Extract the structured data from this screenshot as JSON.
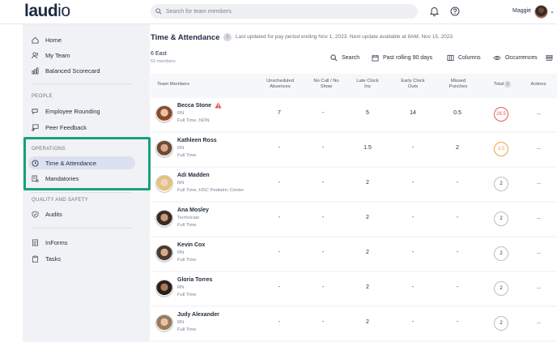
{
  "header": {
    "logo_main": "laud",
    "logo_suffix": "io",
    "search_placeholder": "Search for team members",
    "user_name": "Maggie"
  },
  "sidebar": {
    "top_items": [
      {
        "label": "Home",
        "icon": "home-icon"
      },
      {
        "label": "My Team",
        "icon": "team-icon"
      },
      {
        "label": "Balanced Scorecard",
        "icon": "scorecard-icon"
      }
    ],
    "people_title": "PEOPLE",
    "people_items": [
      {
        "label": "Employee Rounding",
        "icon": "rounding-icon"
      },
      {
        "label": "Peer Feedback",
        "icon": "feedback-icon"
      }
    ],
    "operations_title": "OPERATIONS",
    "operations_items": [
      {
        "label": "Time & Attendance",
        "icon": "clock-icon",
        "active": true
      },
      {
        "label": "Mandatories",
        "icon": "mandatories-icon"
      }
    ],
    "quality_title": "QUALITY AND SAFETY",
    "quality_items": [
      {
        "label": "Audits",
        "icon": "shield-check-icon"
      }
    ],
    "bottom_items": [
      {
        "label": "InForms",
        "icon": "form-icon"
      },
      {
        "label": "Tasks",
        "icon": "clipboard-icon"
      }
    ]
  },
  "page": {
    "title": "Time & Attendance",
    "updated": "Last updated for pay period ending Nov 1, 2023. Next update available at 8AM, Nov 15, 2023",
    "unit": "6 East",
    "members": "53 members",
    "toolbar": {
      "search": "Search",
      "period": "Past rolling 90 days",
      "columns": "Columns",
      "occurrences": "Occurrences"
    }
  },
  "table": {
    "headers": {
      "team_members": "Team Members",
      "unscheduled": "Unscheduled Absences",
      "no_call": "No Call / No Show",
      "late_clock": "Late Clock Ins",
      "early_clock": "Early Clock Outs",
      "missed": "Missed Punches",
      "total": "Total",
      "actions": "Actions"
    },
    "rows": [
      {
        "name": "Becca Stone",
        "role": "RN",
        "employment": "Full Time, NON",
        "unscheduled": "7",
        "no_call": "-",
        "late": "5",
        "early": "14",
        "missed": "0.5",
        "total": "26.5",
        "total_status": "red",
        "warning": true
      },
      {
        "name": "Kathleen Ross",
        "role": "RN",
        "employment": "Full Time",
        "unscheduled": "-",
        "no_call": "-",
        "late": "1.5",
        "early": "-",
        "missed": "2",
        "total": "3.5",
        "total_status": "orange",
        "warning": false
      },
      {
        "name": "Adi Madden",
        "role": "RN",
        "employment": "Full Time, HSC Pediatric Center",
        "unscheduled": "-",
        "no_call": "-",
        "late": "2",
        "early": "-",
        "missed": "-",
        "total": "2",
        "total_status": "normal",
        "warning": false
      },
      {
        "name": "Ana Mosley",
        "role": "Technician",
        "employment": "Full Time",
        "unscheduled": "-",
        "no_call": "-",
        "late": "2",
        "early": "-",
        "missed": "-",
        "total": "2",
        "total_status": "normal",
        "warning": false
      },
      {
        "name": "Kevin Cox",
        "role": "RN",
        "employment": "Full Time",
        "unscheduled": "-",
        "no_call": "-",
        "late": "2",
        "early": "-",
        "missed": "-",
        "total": "2",
        "total_status": "normal",
        "warning": false
      },
      {
        "name": "Gloria Torres",
        "role": "RN",
        "employment": "Full Time",
        "unscheduled": "-",
        "no_call": "-",
        "late": "2",
        "early": "-",
        "missed": "-",
        "total": "2",
        "total_status": "normal",
        "warning": false
      },
      {
        "name": "Judy Alexander",
        "role": "RN",
        "employment": "Full Time",
        "unscheduled": "-",
        "no_call": "-",
        "late": "2",
        "early": "-",
        "missed": "-",
        "total": "2",
        "total_status": "normal",
        "warning": false
      }
    ]
  },
  "colors": {
    "accent": "#17a17c",
    "total_red": "#e25b4b",
    "total_orange": "#f0a040",
    "active_pill": "#dbe1ee"
  }
}
